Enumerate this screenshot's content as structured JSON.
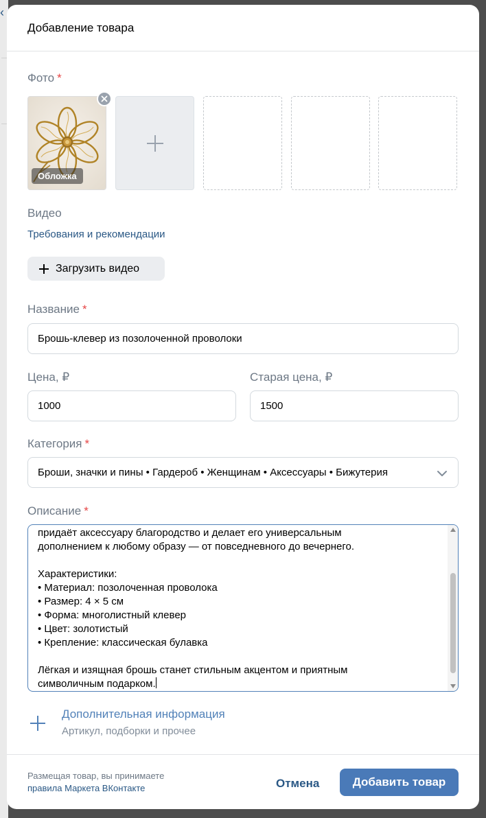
{
  "modal": {
    "title": "Добавление товара"
  },
  "photo": {
    "label": "Фото",
    "required_mark": "*",
    "cover_badge": "Обложка"
  },
  "video": {
    "label": "Видео",
    "requirements_link": "Требования и рекомендации",
    "upload_button": "Загрузить видео"
  },
  "name": {
    "label": "Название",
    "required_mark": "*",
    "value": "Брошь-клевер из позолоченной проволоки"
  },
  "price": {
    "label": "Цена, ₽",
    "value": "1000"
  },
  "old_price": {
    "label": "Старая цена, ₽",
    "value": "1500"
  },
  "category": {
    "label": "Категория",
    "required_mark": "*",
    "value": "Броши, значки и пины • Гардероб • Женщинам • Аксессуары • Бижутерия"
  },
  "description": {
    "label": "Описание",
    "required_mark": "*",
    "lines": [
      "придаёт аксессуару благородство и делает его универсальным",
      "дополнением к любому образу — от повседневного до вечернего.",
      "",
      "Характеристики:",
      "• Материал: позолоченная проволока",
      "• Размер: 4 × 5 см",
      "• Форма: многолистный клевер",
      "• Цвет: золотистый",
      "• Крепление: классическая булавка",
      "",
      "Лёгкая и изящная брошь станет стильным акцентом и приятным",
      "символичным подарком."
    ]
  },
  "extra_info": {
    "title": "Дополнительная информация",
    "subtitle": "Артикул, подборки и прочее"
  },
  "footer": {
    "note": "Размещая товар, вы принимаете",
    "rules_link": "правила Маркета ВКонтакте",
    "cancel_button": "Отмена",
    "submit_button": "Добавить товар"
  }
}
